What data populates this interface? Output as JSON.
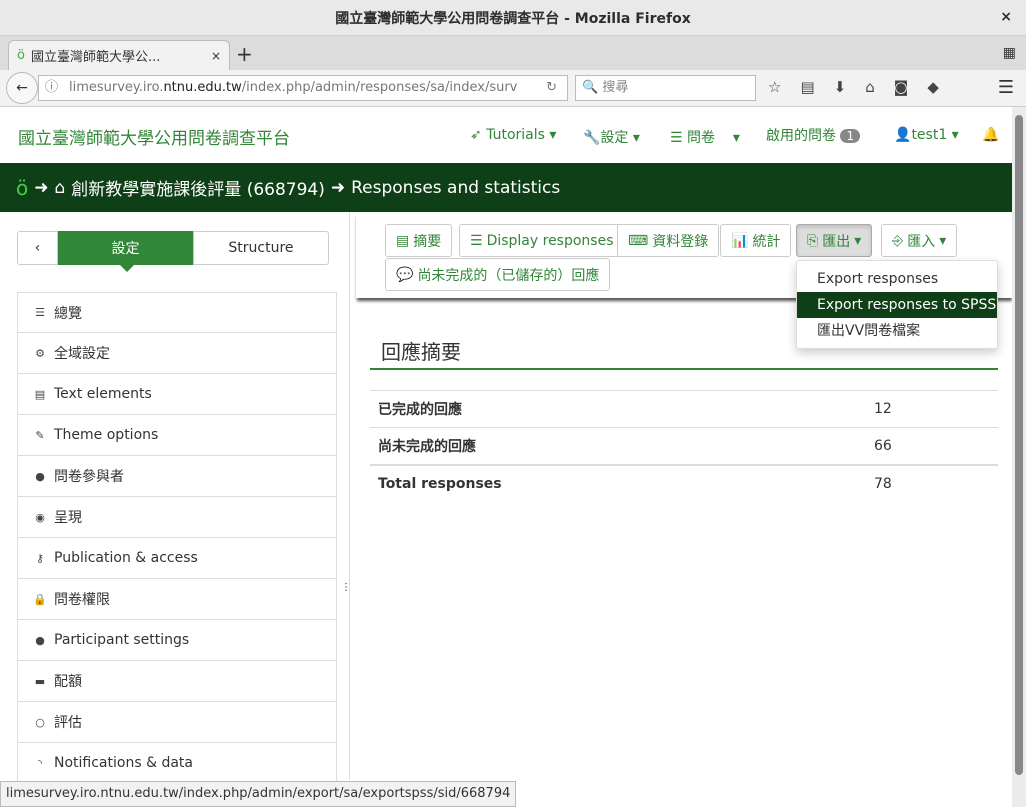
{
  "window": {
    "title": "國立臺灣師範大學公用問卷調查平台 - Mozilla Firefox",
    "close": "×"
  },
  "browser": {
    "tab_title": "國立臺灣師範大學公...",
    "tab_close": "×",
    "new_tab": "+",
    "url_host_pre": "limesurvey.iro.",
    "url_host": "ntnu.edu.tw",
    "url_path": "/index.php/admin/responses/sa/index/surv",
    "search_placeholder": "搜尋",
    "status_url": "limesurvey.iro.ntnu.edu.tw/index.php/admin/export/sa/exportspss/sid/668794"
  },
  "topnav": {
    "brand": "國立臺灣師範大學公用問卷調查平台",
    "tutorials": "Tutorials",
    "settings": "設定",
    "surveys": "問卷",
    "active_surveys": "啟用的問卷",
    "active_count": "1",
    "user": "test1"
  },
  "header": {
    "survey": "創新教學實施課後評量 (668794)",
    "page": "Responses and statistics"
  },
  "sidebar": {
    "tab_settings": "設定",
    "tab_structure": "Structure",
    "items": [
      {
        "label": "總覽",
        "icon": "list-icon",
        "glyph": "☰"
      },
      {
        "label": "全域設定",
        "icon": "gears-icon",
        "glyph": "⚙"
      },
      {
        "label": "Text elements",
        "icon": "file-text-icon",
        "glyph": "▤"
      },
      {
        "label": "Theme options",
        "icon": "brush-icon",
        "glyph": "✎"
      },
      {
        "label": "問卷參與者",
        "icon": "user-icon",
        "glyph": "●"
      },
      {
        "label": "呈現",
        "icon": "eye-slash-icon",
        "glyph": "◉"
      },
      {
        "label": "Publication & access",
        "icon": "key-icon",
        "glyph": "⚷"
      },
      {
        "label": "問卷權限",
        "icon": "lock-icon",
        "glyph": "🔒"
      },
      {
        "label": "Participant settings",
        "icon": "users-icon",
        "glyph": "●"
      },
      {
        "label": "配額",
        "icon": "tasks-icon",
        "glyph": "▬"
      },
      {
        "label": "評估",
        "icon": "comment-icon",
        "glyph": "○"
      },
      {
        "label": "Notifications & data",
        "icon": "rss-icon",
        "glyph": "◝"
      }
    ]
  },
  "toolbar": {
    "summary": "摘要",
    "display": "Display responses",
    "data_entry": "資料登錄",
    "stats": "統計",
    "export": "匯出",
    "import": "匯入",
    "partial": "尚未完成的（已儲存的）回應"
  },
  "export_menu": [
    "Export responses",
    "Export responses to SPSS",
    "匯出VV問卷檔案"
  ],
  "summary": {
    "title": "回應摘要",
    "rows": [
      {
        "label": "已完成的回應",
        "value": "12"
      },
      {
        "label": "尚未完成的回應",
        "value": "66"
      },
      {
        "label": "Total responses",
        "value": "78"
      }
    ]
  },
  "colors": {
    "brand": "#328637",
    "header": "#0f3f17"
  }
}
